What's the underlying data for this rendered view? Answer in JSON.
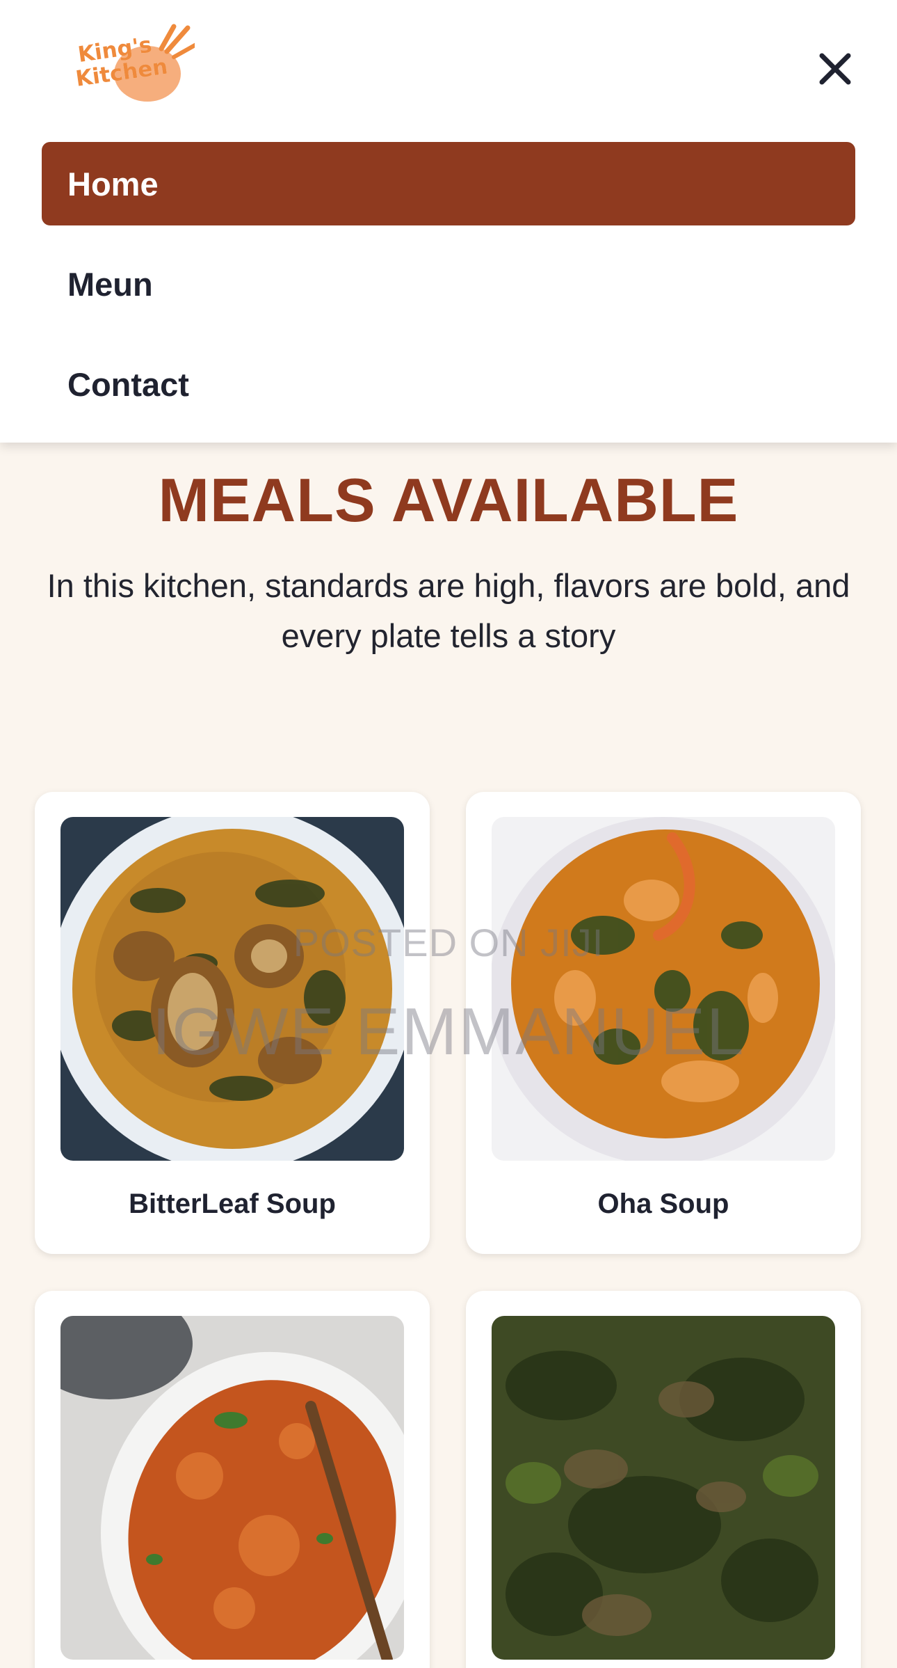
{
  "logo": {
    "line1": "King's",
    "line2": "Kitchen"
  },
  "nav": {
    "items": [
      {
        "label": "Home",
        "active": true
      },
      {
        "label": "Meun",
        "active": false
      },
      {
        "label": "Contact",
        "active": false
      }
    ]
  },
  "section": {
    "title": "MEALS AVAILABLE",
    "subtitle": "In this kitchen, standards are high, flavors are bold, and every plate tells a story"
  },
  "meals": [
    {
      "name": "BitterLeaf Soup"
    },
    {
      "name": "Oha Soup"
    },
    {
      "name": ""
    },
    {
      "name": ""
    }
  ],
  "watermark": {
    "line1": "POSTED ON JIJI",
    "line2": "IGWE EMMANUEL"
  },
  "colors": {
    "accent": "#8f3a1f",
    "logo_orange": "#ef8a3c",
    "page_bg": "#fbf5ee",
    "text": "#1f2230"
  },
  "icons": {
    "close": "close-icon"
  }
}
